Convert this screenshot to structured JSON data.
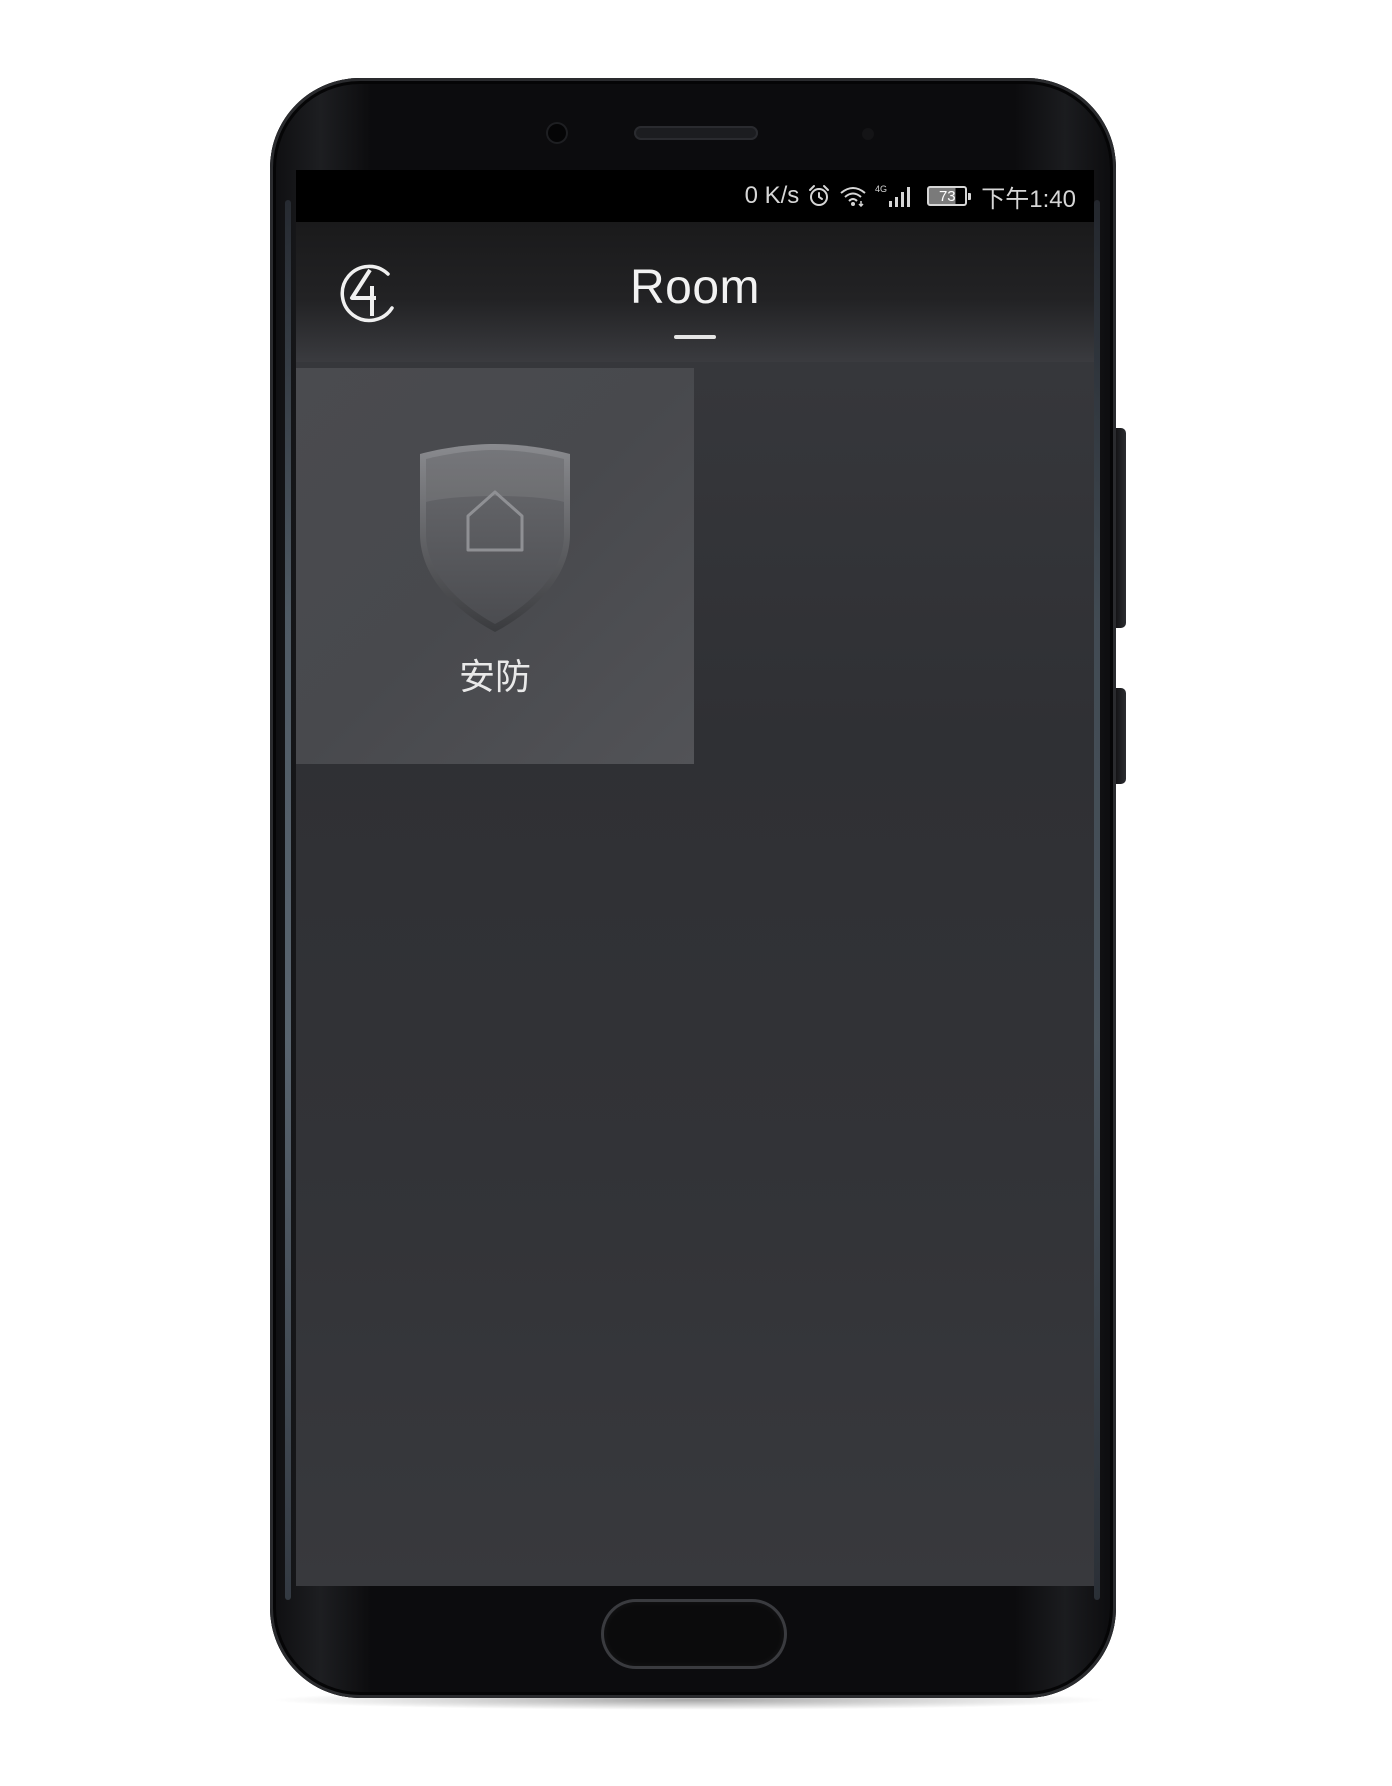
{
  "status_bar": {
    "net_speed": "0 K/s",
    "alarm_icon": "alarm-clock-icon",
    "wifi_icon": "wifi-icon",
    "network_type": "4G",
    "signal_icon": "signal-bars-icon",
    "battery_level": "73",
    "time": "下午1:40"
  },
  "header": {
    "logo_icon": "app-logo-icon",
    "title": "Room"
  },
  "tiles": [
    {
      "icon": "security-shield-icon",
      "label": "安防"
    }
  ],
  "colors": {
    "screen_bg": "#323337",
    "tile_bg": "#4a4b4f",
    "status_bar_bg": "#000000",
    "text": "#f2f2f2"
  }
}
